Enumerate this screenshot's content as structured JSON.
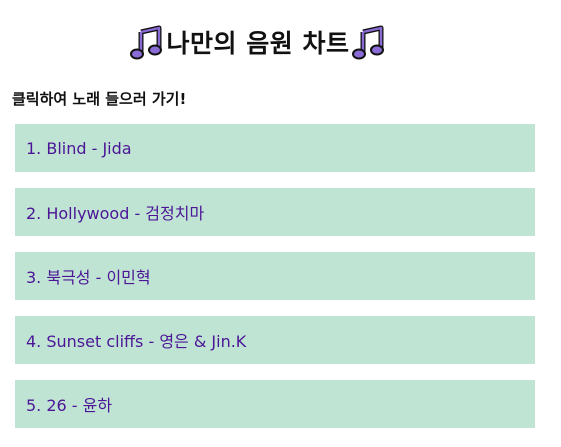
{
  "header": {
    "title": "나만의 음원 차트",
    "left_icon": "music-note-icon",
    "right_icon": "music-note-icon",
    "icon_color": "#8a6bd6"
  },
  "instruction": "클릭하여 노래 들으러 가기!",
  "songs": [
    {
      "label": "1. Blind - Jida"
    },
    {
      "label": "2. Hollywood - 검정치마"
    },
    {
      "label": "3. 북극성 - 이민혁"
    },
    {
      "label": "4. Sunset cliffs - 영은 & Jin.K"
    },
    {
      "label": "5. 26 - 윤하"
    }
  ],
  "colors": {
    "item_background": "#bfe4d4",
    "item_text": "#4b1596",
    "title_text": "#111111"
  }
}
